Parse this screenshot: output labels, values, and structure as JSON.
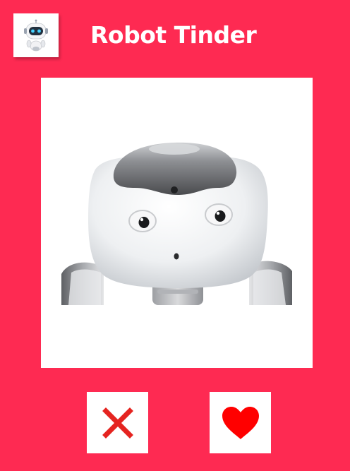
{
  "header": {
    "title": "Robot Tinder",
    "app_icon": "robot-avatar-icon"
  },
  "card": {
    "photo": "nao-robot-head"
  },
  "actions": {
    "nope_icon": "close-icon",
    "like_icon": "heart-icon"
  },
  "colors": {
    "background": "#fe2a52",
    "nope": "#e52420",
    "like": "#ff0000",
    "surface": "#ffffff"
  }
}
